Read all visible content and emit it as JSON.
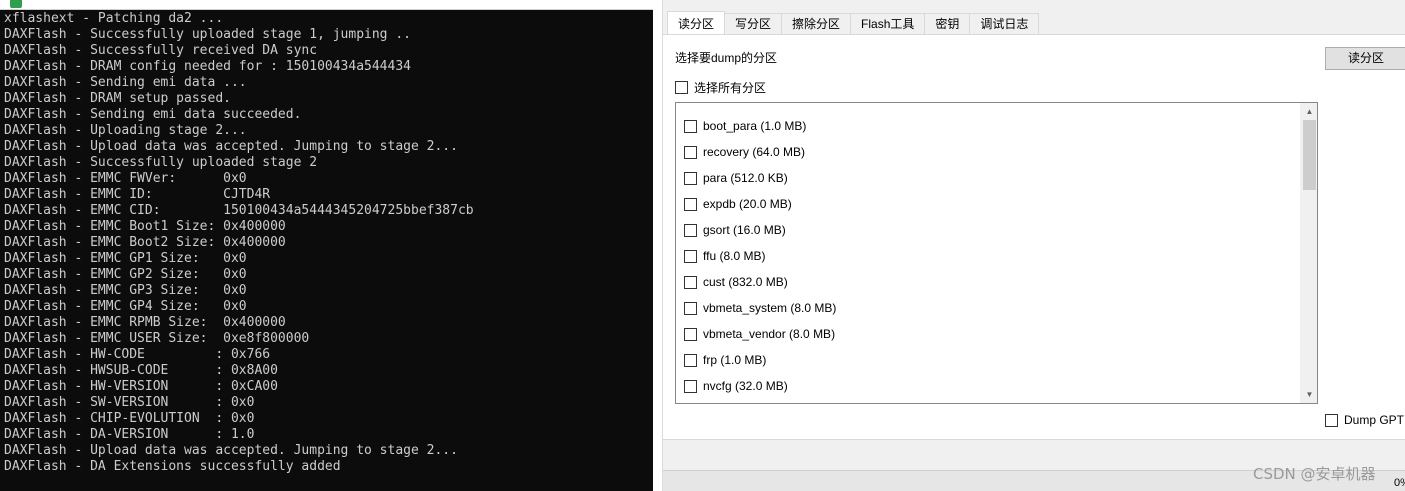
{
  "console": {
    "lines": [
      "xflashext - Patching da2 ...",
      "DAXFlash - Successfully uploaded stage 1, jumping ..",
      "DAXFlash - Successfully received DA sync",
      "DAXFlash - DRAM config needed for : 150100434a544434",
      "DAXFlash - Sending emi data ...",
      "DAXFlash - DRAM setup passed.",
      "DAXFlash - Sending emi data succeeded.",
      "DAXFlash - Uploading stage 2...",
      "DAXFlash - Upload data was accepted. Jumping to stage 2...",
      "DAXFlash - Successfully uploaded stage 2",
      "DAXFlash - EMMC FWVer:      0x0",
      "DAXFlash - EMMC ID:         CJTD4R",
      "DAXFlash - EMMC CID:        150100434a5444345204725bbef387cb",
      "DAXFlash - EMMC Boot1 Size: 0x400000",
      "DAXFlash - EMMC Boot2 Size: 0x400000",
      "DAXFlash - EMMC GP1 Size:   0x0",
      "DAXFlash - EMMC GP2 Size:   0x0",
      "DAXFlash - EMMC GP3 Size:   0x0",
      "DAXFlash - EMMC GP4 Size:   0x0",
      "DAXFlash - EMMC RPMB Size:  0x400000",
      "DAXFlash - EMMC USER Size:  0xe8f800000",
      "DAXFlash - HW-CODE         : 0x766",
      "DAXFlash - HWSUB-CODE      : 0x8A00",
      "DAXFlash - HW-VERSION      : 0xCA00",
      "DAXFlash - SW-VERSION      : 0x0",
      "DAXFlash - CHIP-EVOLUTION  : 0x0",
      "DAXFlash - DA-VERSION      : 1.0",
      "DAXFlash - Upload data was accepted. Jumping to stage 2...",
      "DAXFlash - DA Extensions successfully added"
    ]
  },
  "tabs": [
    {
      "label": "读分区",
      "active": true
    },
    {
      "label": "写分区",
      "active": false
    },
    {
      "label": "擦除分区",
      "active": false
    },
    {
      "label": "Flash工具",
      "active": false
    },
    {
      "label": "密钥",
      "active": false
    },
    {
      "label": "调试日志",
      "active": false
    }
  ],
  "read_panel": {
    "select_label": "选择要dump的分区",
    "read_button": "读分区",
    "select_all_label": "选择所有分区",
    "dump_gpt_label": "Dump GPT",
    "partitions": [
      {
        "label": "boot_para (1.0 MB)",
        "checked": false
      },
      {
        "label": "recovery (64.0 MB)",
        "checked": false
      },
      {
        "label": "para (512.0 KB)",
        "checked": false
      },
      {
        "label": "expdb (20.0 MB)",
        "checked": false
      },
      {
        "label": "gsort (16.0 MB)",
        "checked": false
      },
      {
        "label": "ffu (8.0 MB)",
        "checked": false
      },
      {
        "label": "cust (832.0 MB)",
        "checked": false
      },
      {
        "label": "vbmeta_system (8.0 MB)",
        "checked": false
      },
      {
        "label": "vbmeta_vendor (8.0 MB)",
        "checked": false
      },
      {
        "label": "frp (1.0 MB)",
        "checked": false
      },
      {
        "label": "nvcfg (32.0 MB)",
        "checked": false
      }
    ]
  },
  "status": {
    "text": "0%"
  },
  "watermark": "CSDN @安卓机器",
  "icons": {
    "scroll_up": "up-arrow-icon",
    "scroll_down": "down-arrow-icon",
    "app": "terminal-app-icon"
  }
}
